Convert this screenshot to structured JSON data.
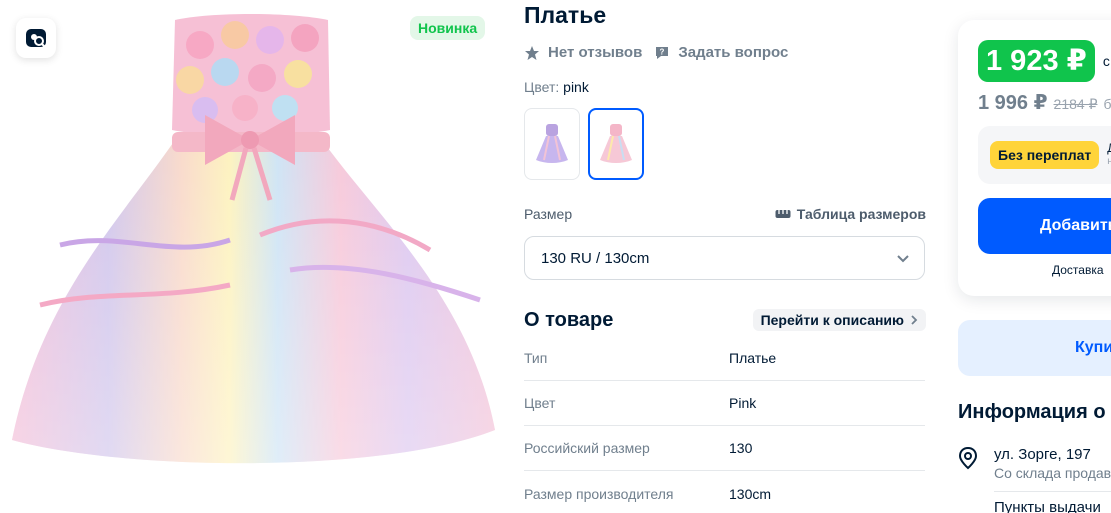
{
  "product": {
    "badge": "Новинка",
    "title": "Платье",
    "reviews_label": "Нет отзывов",
    "ask_label": "Задать вопрос",
    "color_label": "Цвет:",
    "color_value": "pink"
  },
  "size": {
    "label": "Размер",
    "table_link": "Таблица размеров",
    "selected": "130 RU / 130cm"
  },
  "about": {
    "title": "О товаре",
    "go_to_description": "Перейти к описанию",
    "specs": [
      {
        "key": "Тип",
        "value": "Платье"
      },
      {
        "key": "Цвет",
        "value": "Pink"
      },
      {
        "key": "Российский размер",
        "value": "130"
      },
      {
        "key": "Размер производителя",
        "value": "130cm"
      }
    ]
  },
  "price": {
    "card_price": "1 923 ₽",
    "card_suffix": "с О",
    "regular_price": "1 996 ₽",
    "old_price": "2184 ₽",
    "regular_suffix": "бє",
    "promo_pill": "Без переплат",
    "promo_line1": "Д",
    "promo_line2": "н",
    "add_button": "Добавить",
    "delivery_text": "Доставка"
  },
  "buy_button": "Купи",
  "seller_info": {
    "title": "Информация о д",
    "address": "ул. Зорге, 197",
    "address_sub": "Со склада продав",
    "pickup_points": "Пункты выдачи"
  },
  "colors": {
    "accent": "#005bff",
    "price_green": "#10c44c",
    "promo_yellow": "#ffd43a"
  }
}
